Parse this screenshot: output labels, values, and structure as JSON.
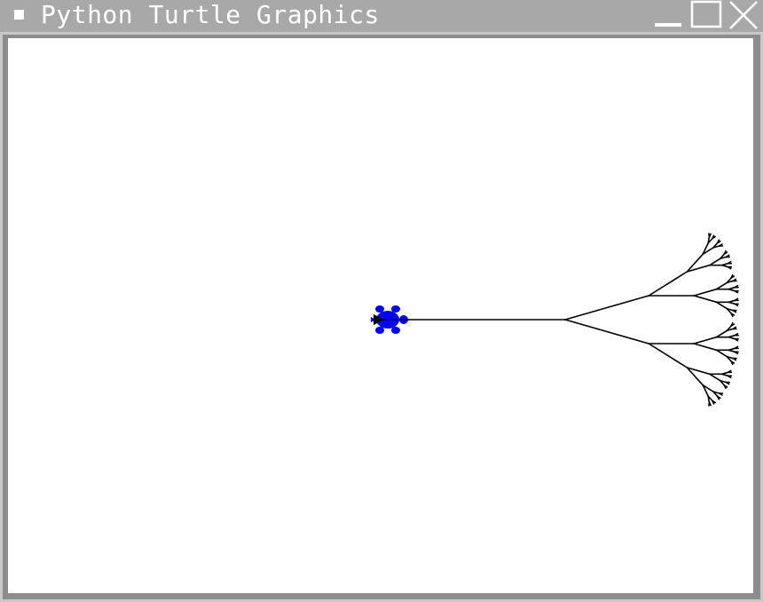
{
  "window": {
    "title": "Python Turtle Graphics",
    "menu_icon": "window-menu-icon",
    "controls": [
      "minimize-icon",
      "maximize-icon",
      "close-icon"
    ]
  },
  "canvas": {
    "background": "#ffffff",
    "pen_color": "#000000",
    "turtle_color": "#0000ff",
    "turtle_shape": "turtle-icon"
  },
  "colors": {
    "titlebar": "#a8a8a8",
    "title_text": "#ffffff",
    "frame": "#c8c8c8"
  }
}
